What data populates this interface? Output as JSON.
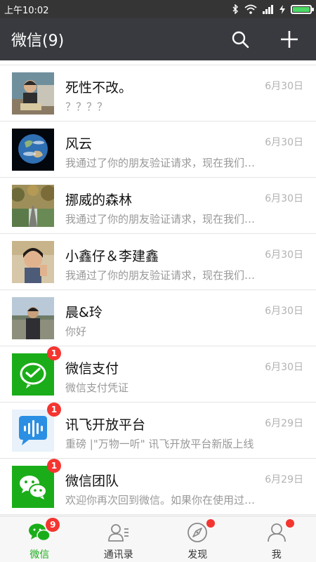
{
  "status_bar": {
    "time": "上午10:02",
    "battery_level": 1.0
  },
  "header": {
    "title": "微信(9)"
  },
  "chats": [
    {
      "name": "死性不改。",
      "time": "6月30日",
      "preview": "？？？？",
      "avatar": "person-photo"
    },
    {
      "name": "风云",
      "time": "6月30日",
      "preview": "我通过了你的朋友验证请求，现在我们可以开始聊天了",
      "avatar": "earth-photo"
    },
    {
      "name": "挪威的森林",
      "time": "6月30日",
      "preview": "我通过了你的朋友验证请求，现在我们可以开始聊天了",
      "avatar": "road-photo"
    },
    {
      "name": "小鑫仔＆李建鑫",
      "time": "6月30日",
      "preview": "我通过了你的朋友验证请求，现在我们可以开始聊天了",
      "avatar": "selfie-photo"
    },
    {
      "name": "晨&玲",
      "time": "6月30日",
      "preview": "你好",
      "avatar": "outdoor-photo"
    },
    {
      "name": "微信支付",
      "time": "6月30日",
      "preview": "微信支付凭证",
      "avatar": "wechat-pay-logo",
      "badge": "1"
    },
    {
      "name": "讯飞开放平台",
      "time": "6月29日",
      "preview": "重磅 |\"万物一听\" 讯飞开放平台新版上线",
      "avatar": "iflytek-logo",
      "badge": "1"
    },
    {
      "name": "微信团队",
      "time": "6月29日",
      "preview": "欢迎你再次回到微信。如果你在使用过程中有任何问题",
      "avatar": "wechat-team-logo",
      "badge": "1"
    }
  ],
  "tabs": [
    {
      "label": "微信",
      "icon": "chat-icon",
      "active": true,
      "badge": "9"
    },
    {
      "label": "通讯录",
      "icon": "contacts-icon",
      "active": false
    },
    {
      "label": "发现",
      "icon": "compass-icon",
      "active": false,
      "dot": true
    },
    {
      "label": "我",
      "icon": "profile-icon",
      "active": false,
      "dot": true
    }
  ],
  "colors": {
    "header": "#393a3f",
    "status_bar": "#353535",
    "accent": "#1aad19",
    "badge": "#f43530"
  }
}
